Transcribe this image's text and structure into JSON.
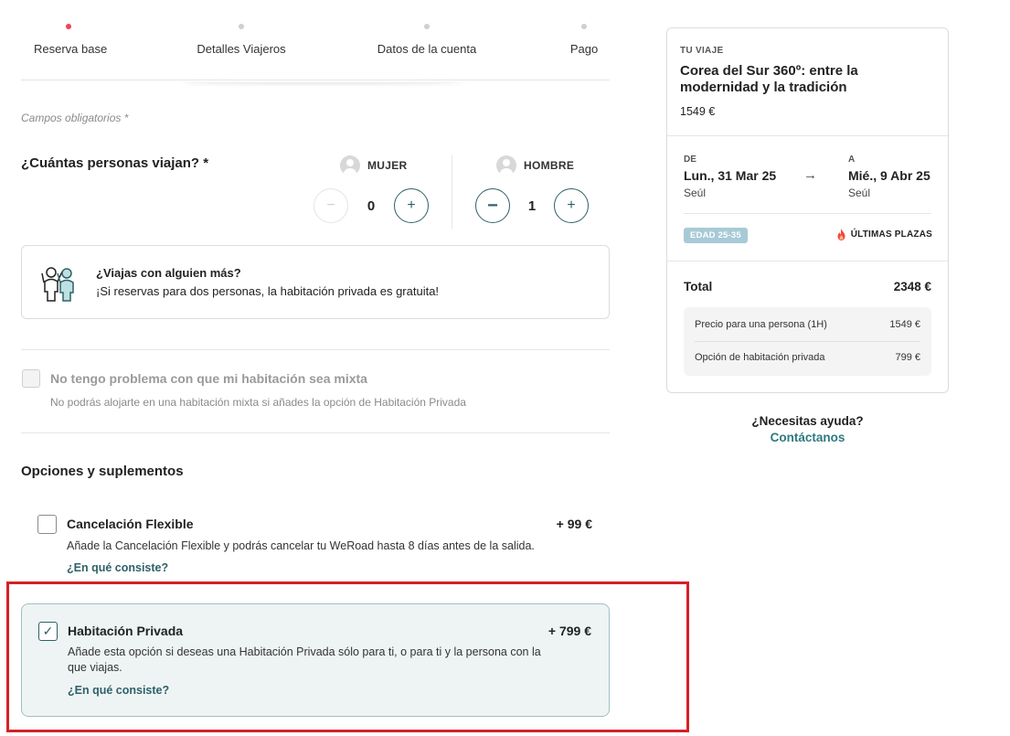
{
  "stepper": {
    "steps": [
      {
        "label": "Reserva base",
        "active": true
      },
      {
        "label": "Detalles Viajeros",
        "active": false
      },
      {
        "label": "Datos de la cuenta",
        "active": false
      },
      {
        "label": "Pago",
        "active": false
      }
    ]
  },
  "form": {
    "required_note": "Campos obligatorios *",
    "travellers_question": "¿Cuántas personas viajan? *",
    "women": {
      "label": "MUJER",
      "count": "0",
      "minus": "−",
      "plus": "+"
    },
    "men": {
      "label": "HOMBRE",
      "count": "1",
      "minus": "−",
      "plus": "+"
    },
    "info": {
      "title": "¿Viajas con alguien más?",
      "text": "¡Si reservas para dos personas, la habitación privada es gratuita!"
    },
    "mixed_room": {
      "label": "No tengo problema con que mi habitación sea mixta",
      "note": "No podrás alojarte en una habitación mixta si añades la opción de Habitación Privada",
      "checked": false
    }
  },
  "options": {
    "title": "Opciones y suplementos",
    "flexible": {
      "title": "Cancelación Flexible",
      "price": "+ 99 €",
      "description": "Añade la Cancelación Flexible y podrás cancelar tu WeRoad hasta 8 días antes de la salida.",
      "link": "¿En qué consiste?",
      "checked": false
    },
    "private_room": {
      "title": "Habitación Privada",
      "price": "+ 799 €",
      "description": "Añade esta opción si deseas una Habitación Privada sólo para ti, o para ti y la persona con la que viajas.",
      "link": "¿En qué consiste?",
      "checked": true,
      "check_glyph": "✓"
    }
  },
  "summary": {
    "kicker": "TU VIAJE",
    "trip_title": "Corea del Sur 360º: entre la modernidad y la tradición",
    "trip_price": "1549 €",
    "from": {
      "label": "DE",
      "date": "Lun., 31 Mar 25",
      "city": "Seúl"
    },
    "to": {
      "label": "A",
      "date": "Mié., 9 Abr 25",
      "city": "Seúl"
    },
    "arrow": "→",
    "age_badge": "EDAD 25-35",
    "last_places": "ÚLTIMAS PLAZAS",
    "total_label": "Total",
    "total_value": "2348 €",
    "breakdown": [
      {
        "label": "Precio para una persona (1H)",
        "value": "1549 €"
      },
      {
        "label": "Opción de habitación privada",
        "value": "799 €"
      }
    ]
  },
  "help": {
    "question": "¿Necesitas ayuda?",
    "link": "Contáctanos"
  },
  "colors": {
    "accent": "#2e6168",
    "active_step": "#f0415a",
    "highlight": "#d42027",
    "badge": "#a8cad6"
  }
}
